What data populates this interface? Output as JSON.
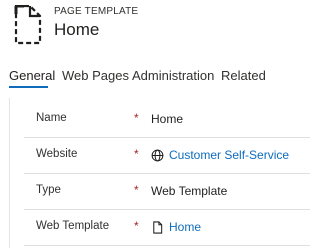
{
  "header": {
    "entity_type": "PAGE TEMPLATE",
    "record_title": "Home",
    "icon": "page-template-icon"
  },
  "tabs": [
    {
      "label": "General",
      "active": true
    },
    {
      "label": "Web Pages",
      "active": false
    },
    {
      "label": "Administration",
      "active": false
    },
    {
      "label": "Related",
      "active": false
    }
  ],
  "fields": {
    "name": {
      "label": "Name",
      "required": "*",
      "value": "Home"
    },
    "website": {
      "label": "Website",
      "required": "*",
      "value": "Customer Self-Service",
      "icon": "globe-icon"
    },
    "type": {
      "label": "Type",
      "required": "*",
      "value": "Web Template"
    },
    "web_template": {
      "label": "Web Template",
      "required": "*",
      "value": "Home",
      "icon": "document-icon"
    }
  },
  "colors": {
    "accent": "#0f6cbd",
    "required": "#a4262c",
    "divider": "#e1dfdd"
  }
}
